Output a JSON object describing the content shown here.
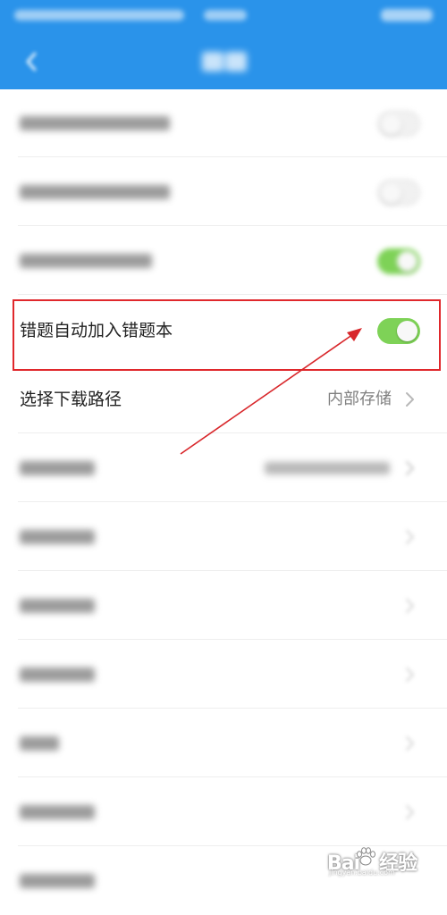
{
  "nav": {
    "back_icon": "chevron-left-icon",
    "title_blurred": true
  },
  "settings": {
    "auto_add_wrong": {
      "label": "错题自动加入错题本",
      "enabled": true
    },
    "download_path": {
      "label": "选择下载路径",
      "value": "内部存储",
      "chevron_icon": "chevron-right-icon"
    }
  },
  "blurred_rows": [
    {
      "kind": "toggle",
      "state": "off"
    },
    {
      "kind": "toggle",
      "state": "off"
    },
    {
      "kind": "toggle",
      "state": "on"
    },
    {
      "kind": "value"
    },
    {
      "kind": "chevron"
    },
    {
      "kind": "chevron"
    },
    {
      "kind": "chevron"
    },
    {
      "kind": "chevron"
    },
    {
      "kind": "chevron"
    },
    {
      "kind": "none"
    }
  ],
  "colors": {
    "header": "#2a93ea",
    "toggle_on": "#7ed257",
    "highlight": "#e0282c"
  },
  "watermark": {
    "logo": "Bai",
    "logo_tail": "经验",
    "url": "jingyan.baidu.com"
  }
}
